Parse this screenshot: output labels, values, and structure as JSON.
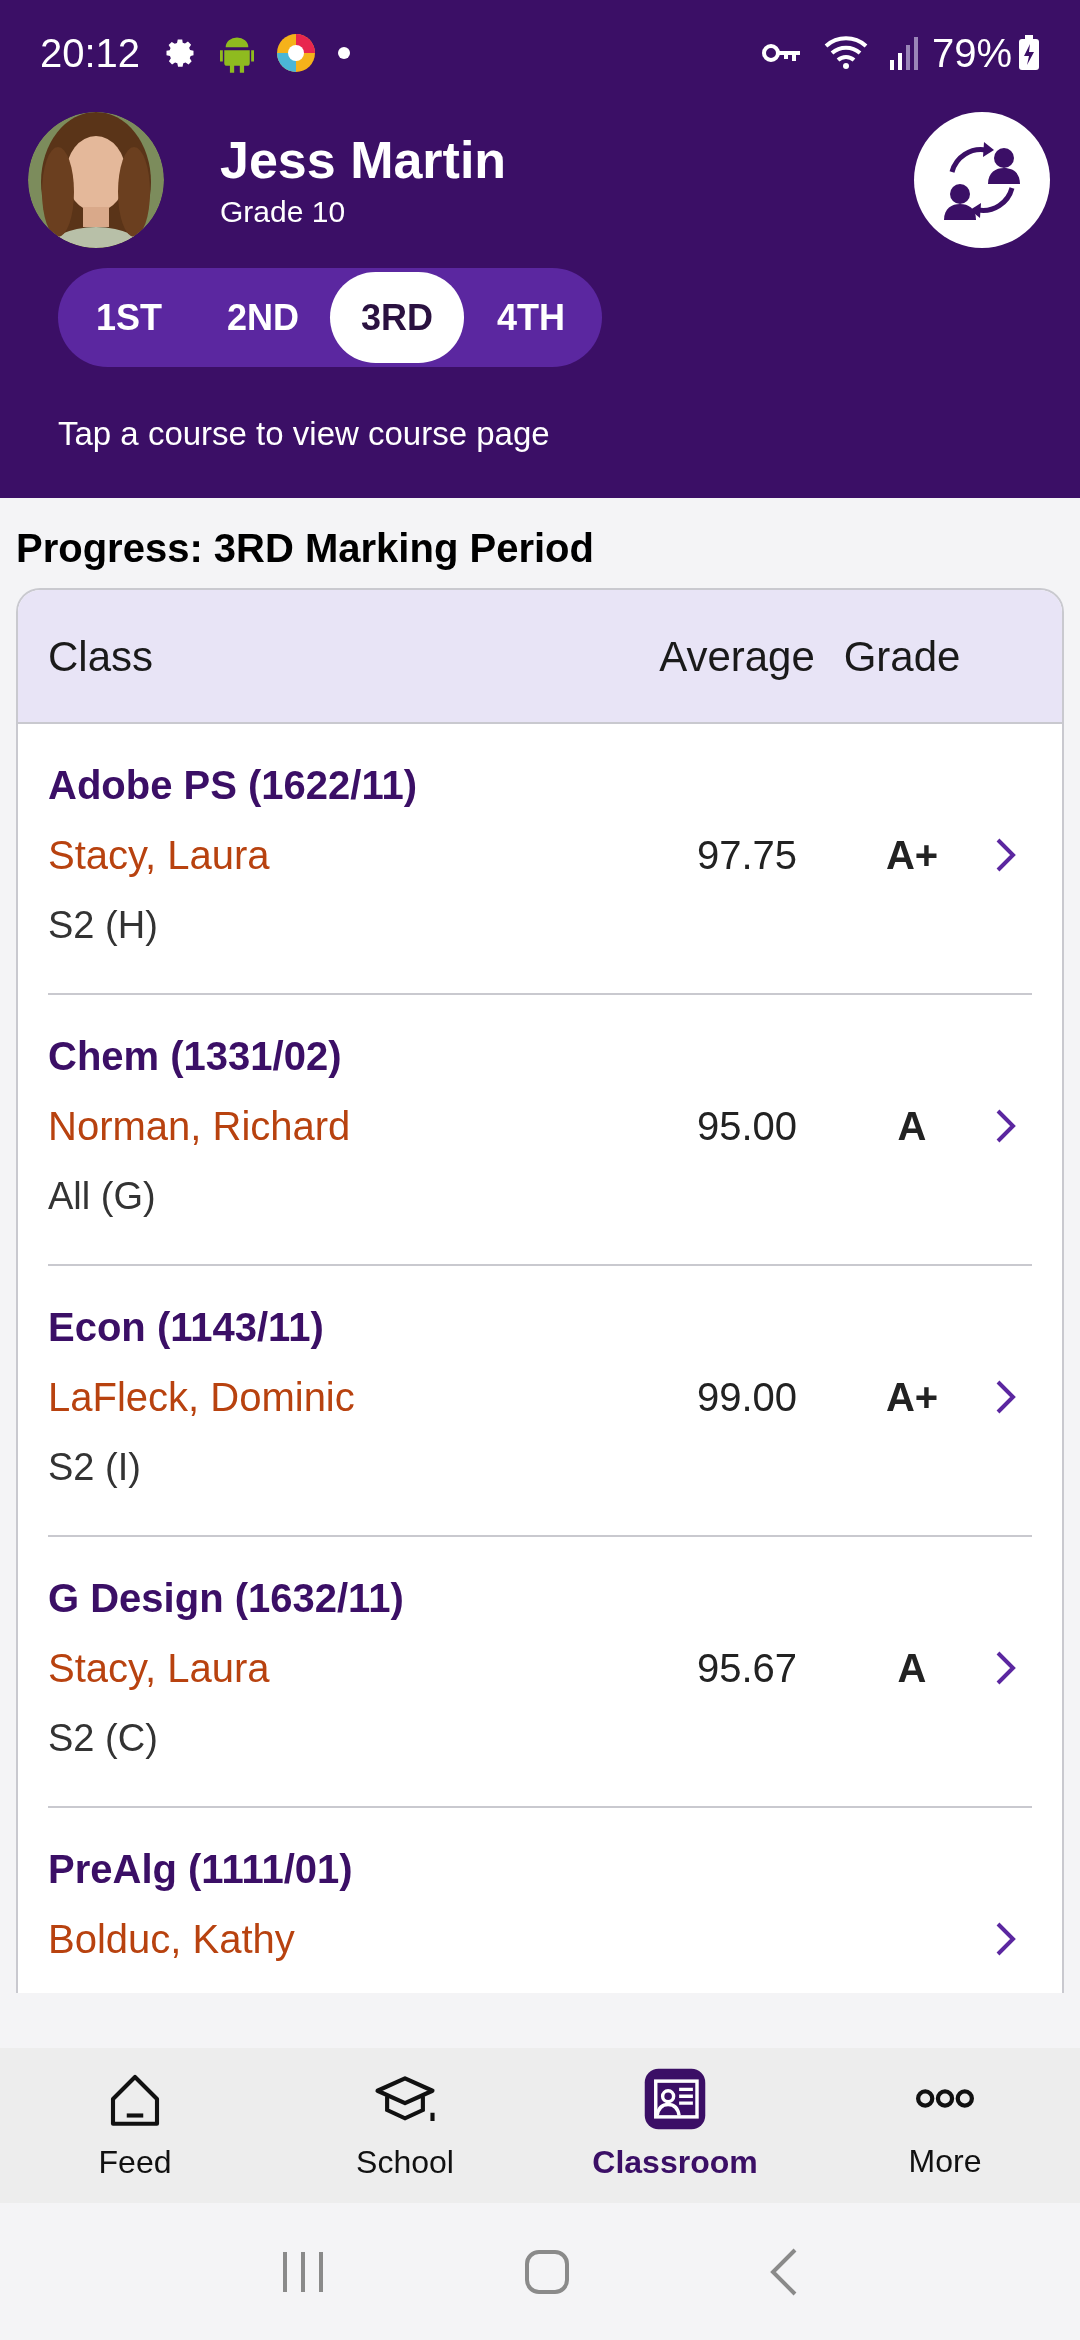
{
  "status_bar": {
    "time": "20:12",
    "battery": "79%"
  },
  "profile": {
    "name": "Jess Martin",
    "grade": "Grade 10"
  },
  "periods": [
    {
      "label": "1ST",
      "selected": false
    },
    {
      "label": "2ND",
      "selected": false
    },
    {
      "label": "3RD",
      "selected": true
    },
    {
      "label": "4TH",
      "selected": false
    }
  ],
  "hint": "Tap a course to view course page",
  "progress_title": "Progress: 3RD Marking Period",
  "table": {
    "columns": [
      "Class",
      "Average",
      "Grade"
    ],
    "rows": [
      {
        "course": "Adobe PS (1622/11)",
        "teacher": "Stacy, Laura",
        "section": "S2 (H)",
        "average": "97.75",
        "grade": "A+"
      },
      {
        "course": "Chem (1331/02)",
        "teacher": "Norman, Richard",
        "section": "All (G)",
        "average": "95.00",
        "grade": "A"
      },
      {
        "course": "Econ (1143/11)",
        "teacher": "LaFleck, Dominic",
        "section": "S2 (I)",
        "average": "99.00",
        "grade": "A+"
      },
      {
        "course": "G Design (1632/11)",
        "teacher": "Stacy, Laura",
        "section": "S2 (C)",
        "average": "95.67",
        "grade": "A"
      },
      {
        "course": "PreAlg (1111/01)",
        "teacher": "Bolduc, Kathy"
      }
    ]
  },
  "bottom_nav": [
    {
      "kind": "home",
      "label": "Feed",
      "selected": false
    },
    {
      "kind": "school",
      "label": "School",
      "selected": false
    },
    {
      "kind": "classroom",
      "label": "Classroom",
      "selected": true
    },
    {
      "kind": "more",
      "label": "More",
      "selected": false
    }
  ]
}
